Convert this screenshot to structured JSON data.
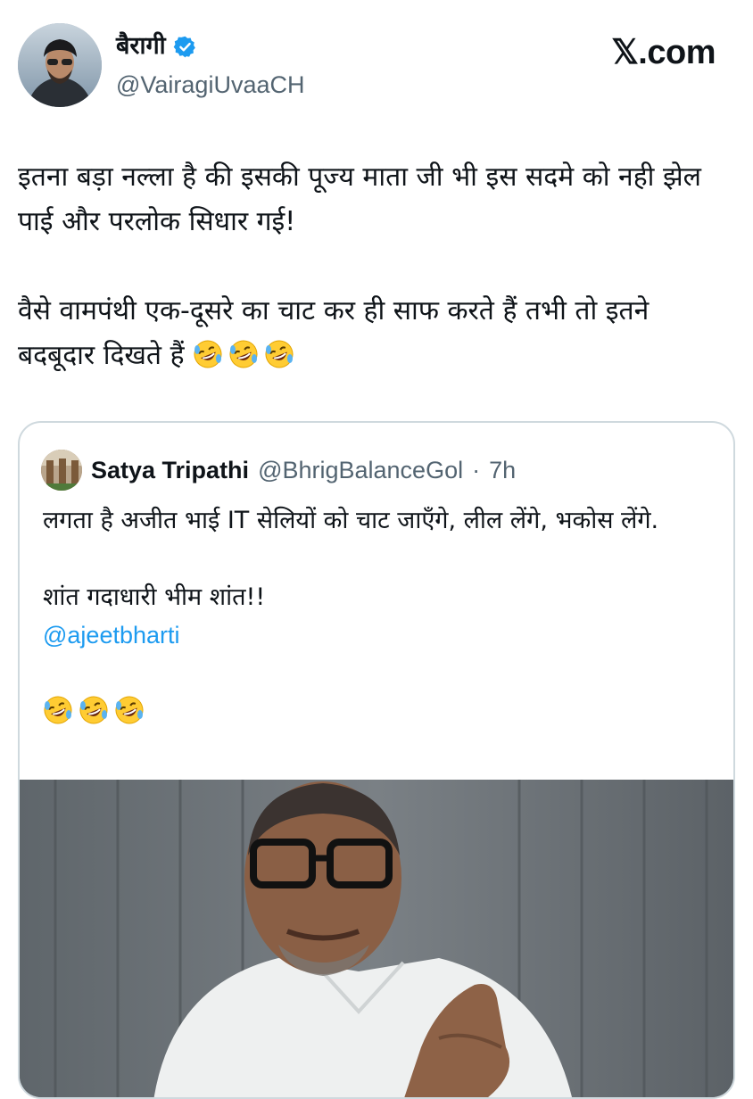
{
  "author": {
    "display_name": "बैरागी",
    "handle": "@VairagiUvaaCH",
    "verified": true,
    "verified_color": "#1d9bf0"
  },
  "brand": "𝕏.com",
  "tweet": {
    "paragraph1": "इतना बड़ा नल्ला है की इसकी पूज्य माता जी भी इस सदमे को नही झेल पाई और परलोक सिधार गई!",
    "paragraph2": "वैसे वामपंथी एक-दूसरे का चाट कर ही साफ करते हैं तभी तो इतने बदबूदार दिखते हैं"
  },
  "quoted": {
    "display_name": "Satya Tripathi",
    "handle": "@BhrigBalanceGol",
    "separator": "·",
    "time": "7h",
    "line1": "लगता है अजीत भाई IT सेलियों को चाट जाएँगे, लील लेंगे, भकोस लेंगे.",
    "line2": "शांत गदाधारी भीम शांत!!",
    "mention": "@ajeetbharti"
  },
  "colors": {
    "text": "#0f1419",
    "secondary": "#536471",
    "link": "#1d9bf0",
    "border": "#cfd9de"
  }
}
